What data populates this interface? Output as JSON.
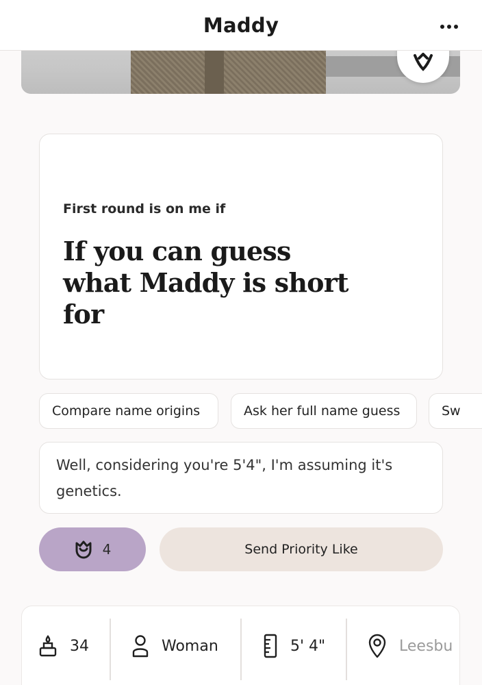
{
  "header": {
    "title": "Maddy",
    "more_icon": "more-horizontal-icon"
  },
  "photo": {
    "action_icon": "rose-outline-icon"
  },
  "prompt": {
    "label": "First round is on me if",
    "answer": "If you can guess what Maddy is short for"
  },
  "suggestions": [
    {
      "label": "Compare name origins"
    },
    {
      "label": "Ask her full name guess"
    },
    {
      "label": "Sw"
    }
  ],
  "comment": {
    "value": "Well, considering you're 5'4\", I'm assuming it's genetics."
  },
  "actions": {
    "rose_icon": "rose-icon",
    "rose_count": "4",
    "rose_button_color": "#b9a5c7",
    "priority_label": "Send Priority Like",
    "priority_button_color": "#ede4de"
  },
  "stats": [
    {
      "icon": "cake-icon",
      "value": "34"
    },
    {
      "icon": "person-icon",
      "value": "Woman"
    },
    {
      "icon": "ruler-icon",
      "value": "5' 4\""
    },
    {
      "icon": "location-pin-icon",
      "value": "Leesbu"
    }
  ]
}
